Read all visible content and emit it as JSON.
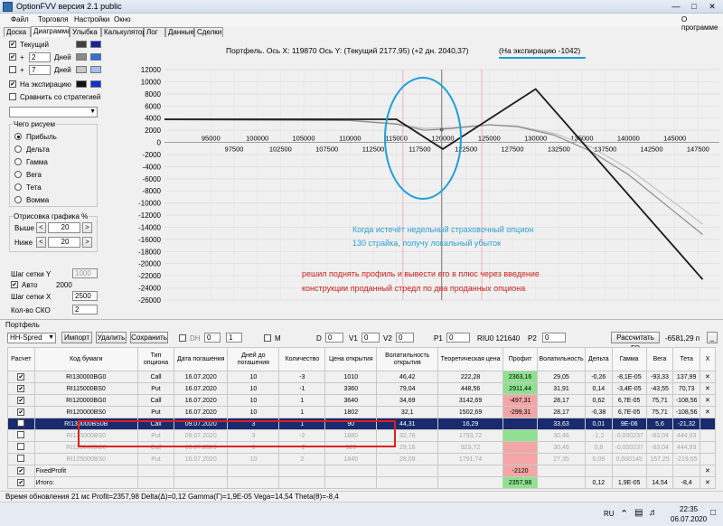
{
  "window": {
    "title": "OptionFVV версия 2.1 public"
  },
  "menu": {
    "items": [
      "Файл",
      "Торговля",
      "Настройки",
      "Окно"
    ],
    "about": "О программе"
  },
  "tabs": [
    "Доска",
    "Диаграмма",
    "Улыбка",
    "Калькулятор",
    "Лог",
    "Данные",
    "Сделки"
  ],
  "left": {
    "current_label": "Текущий",
    "plus1": "+",
    "days1_value": "2",
    "days_label": "Дней",
    "plus2": "+",
    "days2_value": "7",
    "expiry_label": "На экспирацию",
    "compare_label": "Сравнить со стратегией",
    "draw_group": "Чего рисуем",
    "radios": [
      "Прибыль",
      "Дельта",
      "Гамма",
      "Вега",
      "Тета",
      "Вомма"
    ],
    "margin_group": "Отрисовка графика %",
    "above_label": "Выше",
    "above_value": "20",
    "below_label": "Ниже",
    "below_value": "20",
    "gridy_label": "Шаг сетки Y",
    "gridy_value": "1000",
    "auto_label": "Авто",
    "auto_value": "2000",
    "gridx_label": "Шаг сетки X",
    "gridx_value": "2500",
    "sko_label": "Кол-во СКО",
    "sko_value": "2",
    "arrow_left": "<",
    "arrow_right": ">"
  },
  "chart_header": {
    "text": "Портфель. Ось X: 119870 Ось Y:  (Текущий 2177,95)  (+2 дн. 2040,37)",
    "expiry_text": "(На экспирацию -1042)"
  },
  "chart_data": {
    "type": "line",
    "title": "Портфель. Ось X: 119870 Ось Y:  (Текущий 2177,95)  (+2 дн. 2040,37)  (На экспирацию -1042)",
    "xlim": [
      90000,
      150000
    ],
    "ylim": [
      -26000,
      12000
    ],
    "x_ticks_top": [
      95000,
      100000,
      105000,
      110000,
      115000,
      120000,
      125000,
      130000,
      135000,
      140000,
      145000
    ],
    "x_ticks_bottom": [
      97500,
      102500,
      107500,
      112500,
      117500,
      122500,
      127500,
      132500,
      137500,
      142500,
      147500
    ],
    "y_ticks": [
      12000,
      10000,
      8000,
      6000,
      4000,
      2000,
      0,
      -2000,
      -4000,
      -6000,
      -8000,
      -10000,
      -12000,
      -14000,
      -16000,
      -18000,
      -20000,
      -22000,
      -24000,
      -26000
    ],
    "series": [
      {
        "color": "#1a1a1a",
        "x": [
          90000,
          115000,
          120000,
          130000,
          148000
        ],
        "y": [
          3800,
          3800,
          -1100,
          8800,
          -22600
        ]
      },
      {
        "color": "#8c8c8c",
        "x": [
          90000,
          110000,
          115000,
          118000,
          121000,
          125000,
          128000,
          132000,
          136000,
          140000,
          145000,
          148000
        ],
        "y": [
          3750,
          3600,
          3000,
          2000,
          2300,
          2900,
          2600,
          1200,
          -1500,
          -5300,
          -11500,
          -15200
        ]
      },
      {
        "color": "#c2c2c2",
        "x": [
          90000,
          110000,
          115000,
          118000,
          121000,
          125000,
          128000,
          132000,
          136000,
          140000,
          145000,
          148000
        ],
        "y": [
          3750,
          3650,
          3100,
          2300,
          2500,
          2900,
          2700,
          1500,
          -800,
          -4300,
          -10000,
          -13500
        ]
      }
    ],
    "current_x": 119870,
    "pink_lines": [
      115700,
      124200
    ],
    "grid": true
  },
  "annotations": {
    "blue_text_1": "Когда истечёт недельный страховочный опцион",
    "blue_text_2": "130 страйка, получу локальный убыток",
    "red_text_1": "решил поднять профиль и вывести его в плюс  через введение",
    "red_text_2": "конструкции проданный стредл по два проданных опциона"
  },
  "portfolio": {
    "label": "Портфель",
    "select_value": "HH-Spred",
    "import_btn": "Импорт",
    "delete_btn": "Удалить",
    "save_btn": "Сохранить",
    "dh_label": "DH",
    "dh_a": "0",
    "dh_b": "1",
    "m_label": "M",
    "d_label": "D",
    "d_value": "0",
    "v1_label": "V1",
    "v1_value": "0",
    "v2_label": "V2",
    "v2_value": "0",
    "p1_label": "P1",
    "p1_value": "0",
    "riu_label": "RIU0 121640",
    "p2_label": "P2",
    "p2_value": "0",
    "calc_btn": "Рассчитать ГО",
    "go_value": "-6581,29 п",
    "minimize": "_"
  },
  "table": {
    "headers": [
      "Расчет",
      "Код бумаги",
      "Тип опциона",
      "Дата погашения",
      "Дней до погашения",
      "Количество",
      "Цена открытия",
      "Волатильность открытия",
      "Теоретическая цена",
      "Профит",
      "Волатильность",
      "Дельта",
      "Гамма",
      "Вега",
      "Тета",
      "X"
    ],
    "rows": [
      {
        "check": "✔",
        "cells": [
          "RI130000BG0",
          "Call",
          "16.07.2020",
          "10",
          "-3",
          "1010",
          "46,42",
          "222,28",
          "2363,16",
          "29,05",
          "-0,26",
          "-8,1E-05",
          "-93,33",
          "137,99"
        ],
        "profit": "pos",
        "style": ""
      },
      {
        "check": "✔",
        "cells": [
          "RI115000BS0",
          "Put",
          "16.07.2020",
          "10",
          "-1",
          "3360",
          "79,04",
          "448,56",
          "2911,44",
          "31,91",
          "0,14",
          "-3,4E-05",
          "-43,55",
          "70,73"
        ],
        "profit": "pos",
        "style": ""
      },
      {
        "check": "✔",
        "cells": [
          "RI120000BG0",
          "Call",
          "16.07.2020",
          "10",
          "1",
          "3640",
          "34,69",
          "3142,69",
          "-497,31",
          "28,17",
          "0,62",
          "6,7E-05",
          "75,71",
          "-108,56"
        ],
        "profit": "neg",
        "style": ""
      },
      {
        "check": "✔",
        "cells": [
          "RI120000BS0",
          "Put",
          "16.07.2020",
          "10",
          "1",
          "1802",
          "32,1",
          "1502,69",
          "-299,31",
          "28,17",
          "-0,38",
          "6,7E-05",
          "75,71",
          "-108,56"
        ],
        "profit": "neg",
        "style": ""
      },
      {
        "check": "",
        "cells": [
          "RI130000BS0B",
          "Call",
          "09.07.2020",
          "3",
          "1",
          "90",
          "44,31",
          "16,29",
          "",
          "33,63",
          "0,01",
          "9E-06",
          "5,6",
          "-21,32"
        ],
        "profit": "neg",
        "style": "sel"
      },
      {
        "check": "",
        "cells": [
          "RI125000BS0",
          "Put",
          "09.07.2020",
          "3",
          "-2",
          "1880",
          "32,78",
          "1793,72",
          "",
          "30,46",
          "-1,2",
          "-0,000237",
          "-83,04",
          "444,93"
        ],
        "profit": "pos",
        "style": "faded"
      },
      {
        "check": "",
        "cells": [
          "RI125000BG0",
          "Call",
          "09.07.2020",
          "3",
          "-2",
          "920",
          "29,16",
          "923,72",
          "",
          "30,46",
          "0,8",
          "-0,000237",
          "-83,04",
          "444,93"
        ],
        "profit": "neg",
        "style": "faded"
      },
      {
        "check": "",
        "cells": [
          "RI125000BS0",
          "Put",
          "16.07.2020",
          "10",
          "2",
          "1840",
          "28,09",
          "1791,74",
          "",
          "27,35",
          "0,09",
          "0,000145",
          "157,25",
          "-219,65"
        ],
        "profit": "neg",
        "style": "faded"
      },
      {
        "check": "✔",
        "cells": [
          "FixedProfit",
          "",
          "",
          "",
          "",
          "",
          "",
          "",
          "-2120",
          "",
          "",
          "",
          "",
          ""
        ],
        "profit": "neg",
        "style": ""
      },
      {
        "check": "✔",
        "cells": [
          "Итого:",
          "",
          "",
          "",
          "",
          "",
          "",
          "",
          "2357,98",
          "",
          "0,12",
          "1,9E-05",
          "14,54",
          "-8,4"
        ],
        "profit": "pos",
        "style": ""
      }
    ]
  },
  "status": {
    "text": "Время обновления 21 мс  Profit=2357,98 Delta(Δ)=0,12 Gamma(Γ)=1,9E-05 Vega=14,54 Theta(θ)=-8,4"
  },
  "taskbar": {
    "lang": "RU",
    "time": "22:35",
    "date": "06.07.2020"
  },
  "colors": {
    "title_bar": "#d4deec",
    "selected_row": "#1a2a6e",
    "profit_pos": "#8fe18f",
    "profit_neg": "#f4a6a6",
    "blue_text": "#2a9fd8",
    "red_text": "#d42020",
    "ellipse": "#1da0d8",
    "highlight_box": "#e02020"
  }
}
